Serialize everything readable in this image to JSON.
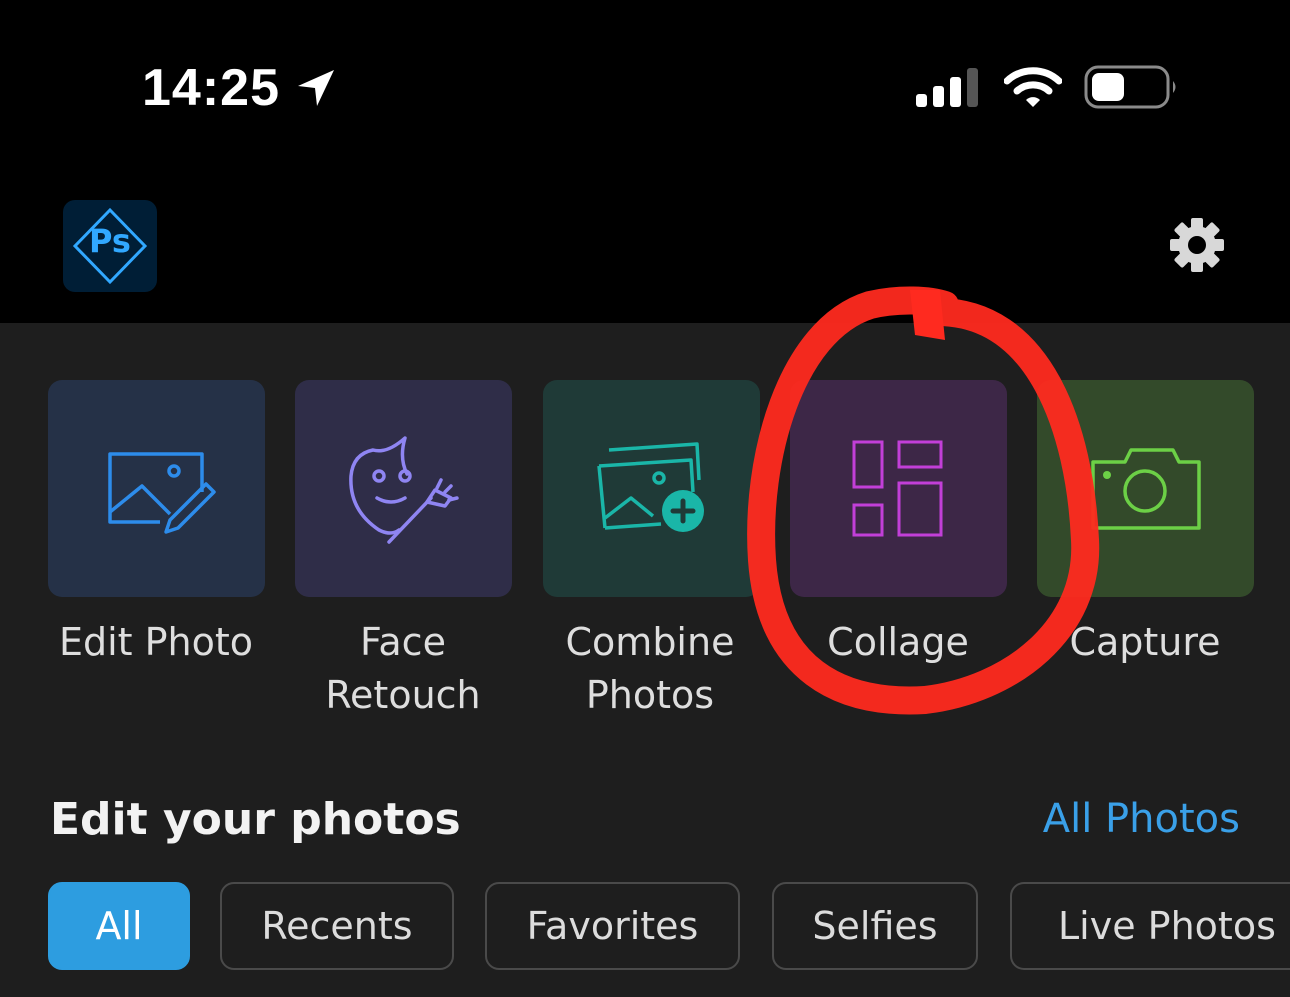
{
  "status_bar": {
    "time": "14:25",
    "icons": [
      "location-arrow-icon",
      "cellular-signal-icon",
      "wifi-icon",
      "battery-icon"
    ]
  },
  "header": {
    "app_logo_text": "Ps",
    "settings_icon": "gear-icon"
  },
  "tools": [
    {
      "label": "Edit Photo",
      "icon": "edit-photo-icon",
      "color": "#2d8ceb"
    },
    {
      "label": "Face\nRetouch",
      "icon": "face-retouch-icon",
      "color": "#8f85f2"
    },
    {
      "label": "Combine\nPhotos",
      "icon": "combine-photos-icon",
      "color": "#1ab6a8"
    },
    {
      "label": "Collage",
      "icon": "collage-icon",
      "color": "#c23fd8"
    },
    {
      "label": "Capture",
      "icon": "camera-icon",
      "color": "#6cd046"
    }
  ],
  "annotation": {
    "type": "red-circle-highlight",
    "target": "Collage",
    "color": "#ff2a1f"
  },
  "photos_section": {
    "title": "Edit your photos",
    "link": "All Photos",
    "filters": [
      "All",
      "Recents",
      "Favorites",
      "Selfies",
      "Live Photos"
    ],
    "active_filter": "All"
  }
}
